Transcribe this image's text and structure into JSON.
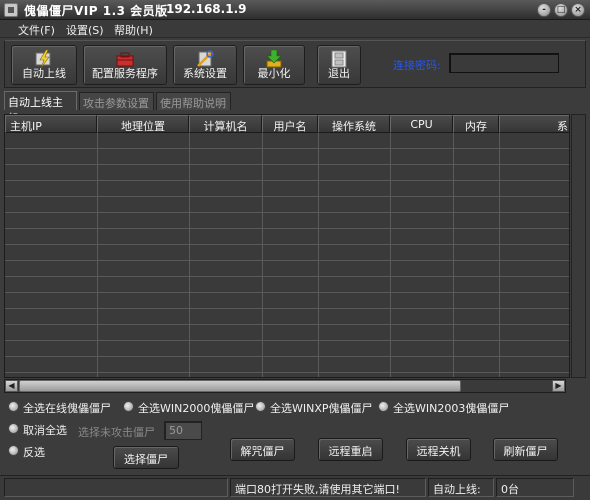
{
  "window": {
    "title": "傀儡僵尸VIP 1.3 会员版",
    "ip": "192.168.1.9"
  },
  "window_buttons": [
    "-",
    "□",
    "×"
  ],
  "menu": [
    {
      "label": "文件(F)"
    },
    {
      "label": "设置(S)"
    },
    {
      "label": "帮助(H)"
    }
  ],
  "toolbar": {
    "auto_online": "自动上线",
    "configure_server": "配置服务程序",
    "system_settings": "系统设置",
    "minimize": "最小化",
    "exit": "退出",
    "password_label": "连接密码:",
    "password_value": ""
  },
  "tabs": [
    "自动上线主机",
    "攻击参数设置",
    "使用帮助说明"
  ],
  "table": {
    "columns": [
      "主机IP",
      "地理位置",
      "计算机名",
      "用户名",
      "操作系统",
      "CPU",
      "内存",
      "系"
    ],
    "rows": []
  },
  "radios": {
    "select_online": "全选在线傀儡僵尸",
    "select_win2000": "全选WIN2000傀儡僵尸",
    "select_winxp": "全选WINXP傀儡僵尸",
    "select_win2003": "全选WIN2003傀儡僵尸",
    "deselect_all": "取消全选",
    "invert": "反选"
  },
  "select_unattacked_label": "选择未攻击僵尸",
  "select_unattacked_value": "50",
  "buttons": {
    "select_zombie": "选择僵尸",
    "uninstall": "解咒僵尸",
    "remote_restart": "远程重启",
    "remote_shutdown": "远程关机",
    "refresh": "刷新僵尸"
  },
  "status": {
    "message": "端口80打开失败,请使用其它端口!",
    "auto_online_label": "自动上线:",
    "count": "0台"
  },
  "colors": {
    "background": "#3c3c3c",
    "password_label": "#2a57e8",
    "text": "#f0f0f0"
  }
}
